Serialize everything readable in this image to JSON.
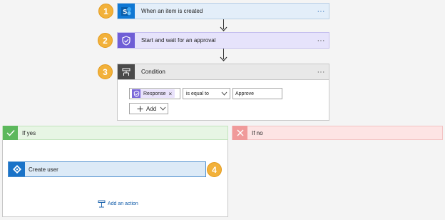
{
  "steps": [
    {
      "number": "1",
      "title": "When an item is created",
      "icon": "sharepoint-icon"
    },
    {
      "number": "2",
      "title": "Start and wait for an approval",
      "icon": "approval-icon"
    },
    {
      "number": "3",
      "title": "Condition",
      "icon": "condition-icon"
    },
    {
      "number": "4",
      "title": "Create user",
      "icon": "azure-ad-icon"
    }
  ],
  "menu_glyph": "···",
  "condition": {
    "token_label": "Response",
    "token_remove": "×",
    "operator": "is equal to",
    "value": "Approve",
    "add_label": "Add"
  },
  "branches": {
    "yes_label": "If yes",
    "no_label": "If no",
    "add_action_label": "Add an action"
  },
  "colors": {
    "sharepoint": "#0f78d4",
    "approval": "#6f5ed6",
    "condition": "#4a4a4a",
    "azure_ad": "#1a73c8",
    "badge": "#f2b13a",
    "yes": "#5cb85c",
    "no": "#f09a9a"
  }
}
